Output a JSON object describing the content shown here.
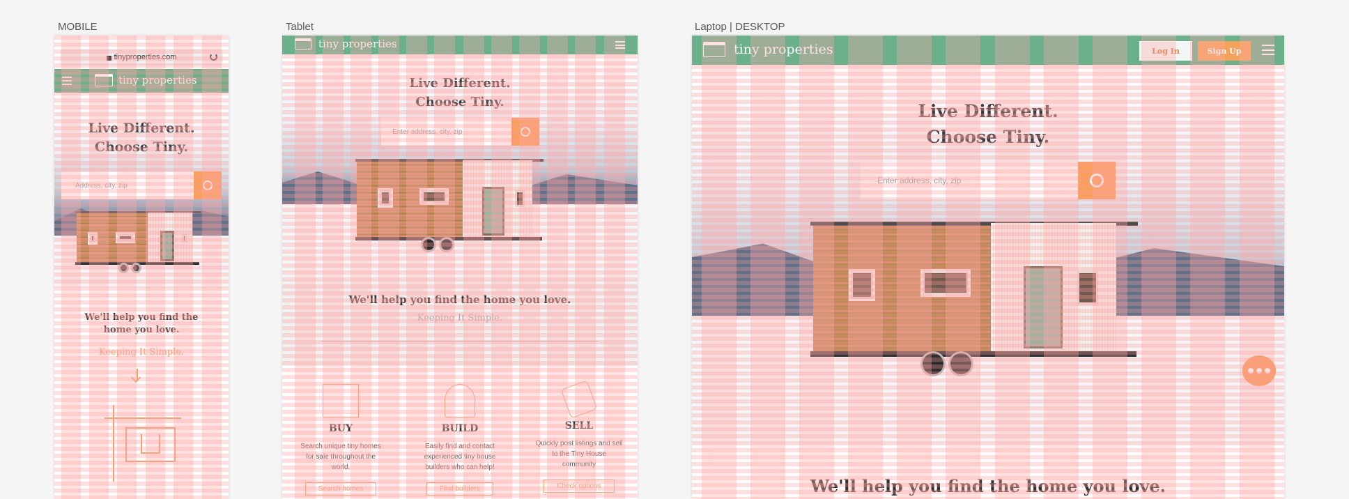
{
  "frames": {
    "mobile_label": "MOBILE",
    "tablet_label": "Tablet",
    "desktop_label": "Laptop | DESKTOP"
  },
  "brand": {
    "name": "tiny properties",
    "logo_icon": "tiny-house-logo-icon"
  },
  "mobile": {
    "url_bar": {
      "url": "tinyproperties.com",
      "lock_icon": "lock-icon",
      "reload_icon": "reload-icon"
    },
    "headline_line1": "Live Different.",
    "headline_line2": "Choose Tiny.",
    "search_placeholder": "Address, city, zip",
    "subhead_line1": "We'll help you find the",
    "subhead_line2": "home you love.",
    "tagline": "Keeping It Simple.",
    "arrow_icon": "arrow-down-icon"
  },
  "tablet": {
    "headline_line1": "Live Different.",
    "headline_line2": "Choose Tiny.",
    "search_placeholder": "Enter address, city, zip",
    "subhead": "We'll help you find the home you love.",
    "tagline": "Keeping It Simple.",
    "features": [
      {
        "title": "BUY",
        "desc": "Search unique tiny homes for sale throughout the world.",
        "button": "Search homes",
        "icon": "for-sale-sign-icon"
      },
      {
        "title": "BUILD",
        "desc": "Easily find and contact experienced tiny house builders who can help!",
        "button": "Find builders",
        "icon": "compass-tool-icon"
      },
      {
        "title": "SELL",
        "desc": "Quickly post listings and sell to the Tiny House community",
        "button": "Check options",
        "icon": "price-tag-icon"
      }
    ]
  },
  "desktop": {
    "login_label": "Log In",
    "signup_label": "Sign Up",
    "headline_line1": "Live Different.",
    "headline_line2": "Choose Tiny.",
    "search_placeholder": "Enter address, city, zip",
    "subhead": "We'll help you find the home you love.",
    "chat_icon": "chat-bubble-icon"
  },
  "colors": {
    "nav_green": "#6bb08b",
    "accent_orange": "#f6a05a",
    "grid_overlay_pink": "#ff9696"
  }
}
